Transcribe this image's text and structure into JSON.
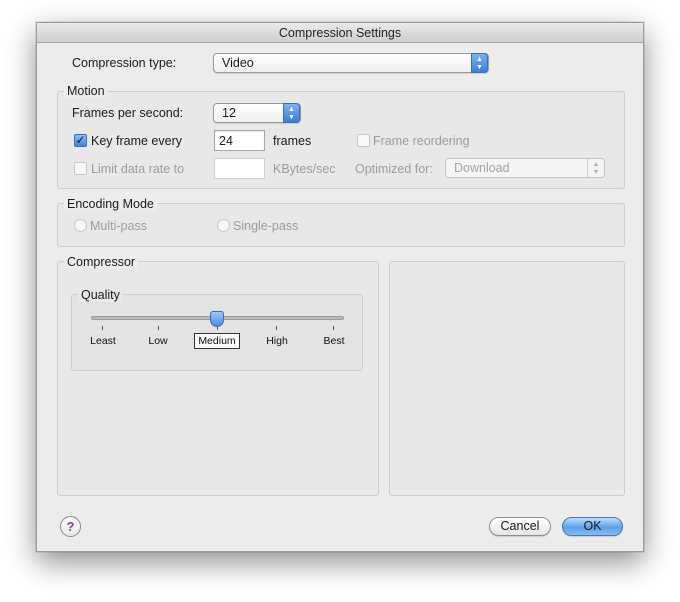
{
  "window": {
    "title": "Compression Settings"
  },
  "compression_type": {
    "label": "Compression type:",
    "value": "Video"
  },
  "motion": {
    "title": "Motion",
    "fps_label": "Frames per second:",
    "fps_value": "12",
    "keyframe_label": "Key frame every",
    "keyframe_value": "24",
    "keyframe_unit": "frames",
    "keyframe_checked": true,
    "frame_reordering_label": "Frame reordering",
    "limit_label": "Limit data rate to",
    "limit_value": "",
    "limit_unit": "KBytes/sec",
    "optimized_label": "Optimized for:",
    "optimized_value": "Download"
  },
  "encoding": {
    "title": "Encoding Mode",
    "multipass_label": "Multi-pass",
    "singlepass_label": "Single-pass"
  },
  "compressor": {
    "title": "Compressor",
    "quality": {
      "title": "Quality",
      "levels": [
        "Least",
        "Low",
        "Medium",
        "High",
        "Best"
      ],
      "selected": "Medium",
      "level": 0.5
    }
  },
  "buttons": {
    "cancel": "Cancel",
    "ok": "OK",
    "help": "?"
  },
  "icons": {
    "stepper": "up-down-arrows-icon",
    "checkmark": "checkmark-icon",
    "help": "question-mark-icon"
  }
}
